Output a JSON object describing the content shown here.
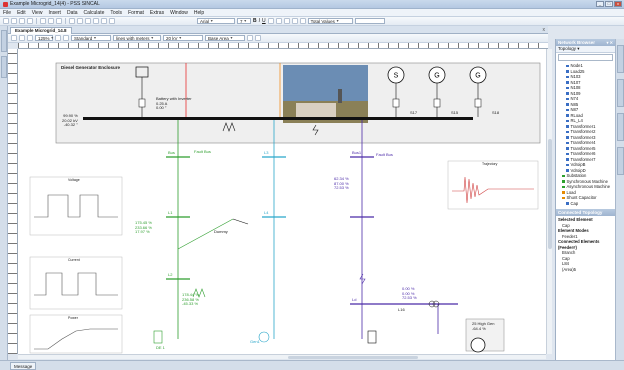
{
  "app": {
    "title": "Example Microgrid_14(4) - PSS SINCAL",
    "window_buttons": [
      "_",
      "□",
      "x"
    ]
  },
  "menu": [
    "File",
    "Edit",
    "View",
    "Insert",
    "Data",
    "Calculate",
    "Tools",
    "Format",
    "Extras",
    "Window",
    "Help"
  ],
  "toolbar": {
    "font_name": "Arial",
    "font_size": "7",
    "format_buttons": [
      "B",
      "I",
      "U"
    ],
    "values_combo": "Total Values",
    "zoom": "125%",
    "style_combo": "Standard",
    "lines_combo": "lines with meters",
    "voltage_combo": "20 kV",
    "area_combo": "Base Area"
  },
  "document": {
    "tab_label": "Example Microgrid_14.8",
    "close": "x",
    "enclosure_title": "Diesel Generator Enclosure",
    "battery_label": "Battery with Inverter",
    "battery_values": [
      "0.25 A",
      "0.00 °"
    ],
    "busbar_values": [
      "99.90 %",
      "20.02 kV",
      "-40.32 °"
    ],
    "bay_labels": [
      "S17",
      "S15",
      "S18"
    ],
    "left_values": [
      "175.45 %",
      "233.66 %",
      "17.97 %"
    ],
    "bottom_values": [
      "178.44 %",
      "236.58 %",
      "-45.33 %"
    ],
    "right_values": [
      "62.34 %",
      "87.00 %",
      "72.53 %"
    ],
    "far_right_values": [
      "0.00 %",
      "0.00 %",
      "72.53 %"
    ],
    "node_labels": [
      "Bus",
      "L1",
      "L2",
      "L3",
      "L4",
      "Bus1",
      "Fault Bus",
      "Dummy",
      "DE 1",
      "Gen1",
      "Ld",
      "L16",
      "L29",
      "L42",
      "L19"
    ],
    "right_node_label": "25 High Gen",
    "right_node_value": "-64.4 %",
    "chart_title": "Trajectory",
    "inset_titles": [
      "Voltage",
      "Current",
      "Power"
    ]
  },
  "network_browser": {
    "title": "Network Browser",
    "pin": "▾ ✕",
    "view_combo": "Topology",
    "items": [
      {
        "label": "Node1",
        "level": 2,
        "color": "b"
      },
      {
        "label": "Load25",
        "level": 2,
        "color": "b"
      },
      {
        "label": "N103",
        "level": 2,
        "color": "b"
      },
      {
        "label": "N107",
        "level": 2,
        "color": "b"
      },
      {
        "label": "N108",
        "level": 2,
        "color": "b"
      },
      {
        "label": "N109",
        "level": 2,
        "color": "b"
      },
      {
        "label": "N74",
        "level": 2,
        "color": "b"
      },
      {
        "label": "N85",
        "level": 2,
        "color": "b"
      },
      {
        "label": "N87",
        "level": 2,
        "color": "b"
      },
      {
        "label": "RLoad",
        "level": 2,
        "color": "b"
      },
      {
        "label": "RL_L4",
        "level": 2,
        "color": "b"
      },
      {
        "label": "Transformer1",
        "level": 2,
        "color": "b"
      },
      {
        "label": "Transformer2",
        "level": 2,
        "color": "b"
      },
      {
        "label": "Transformer3",
        "level": 2,
        "color": "b"
      },
      {
        "label": "Transformer4",
        "level": 2,
        "color": "b"
      },
      {
        "label": "Transformer5",
        "level": 2,
        "color": "b"
      },
      {
        "label": "Transformer6",
        "level": 2,
        "color": "b"
      },
      {
        "label": "Transformer7",
        "level": 2,
        "color": "b"
      },
      {
        "label": "VdroipB",
        "level": 2,
        "color": "b"
      },
      {
        "label": "VdroipD",
        "level": 2,
        "color": "b"
      },
      {
        "label": "Substation",
        "level": 1,
        "color": "g"
      },
      {
        "label": "Synchronous Machine",
        "level": 1,
        "color": "g"
      },
      {
        "label": "Asynchronous Machine",
        "level": 1,
        "color": "g"
      },
      {
        "label": "Load",
        "level": 1,
        "color": "o"
      },
      {
        "label": "Shunt Capacitor",
        "level": 1,
        "color": "o"
      },
      {
        "label": "Cap",
        "level": 2,
        "color": "b"
      }
    ]
  },
  "connected_topology": {
    "title": "Connected Topology",
    "selected_label": "Selected Element",
    "selected_value": "Cap",
    "modes_label": "Element Modes",
    "modes_value": "Feeder1",
    "connected_label": "Connected Elements (Feeder#)",
    "connected_items": [
      "Branch",
      "Cap",
      "L84",
      "(Area)5"
    ]
  },
  "statusbar": {
    "message": "Message"
  }
}
